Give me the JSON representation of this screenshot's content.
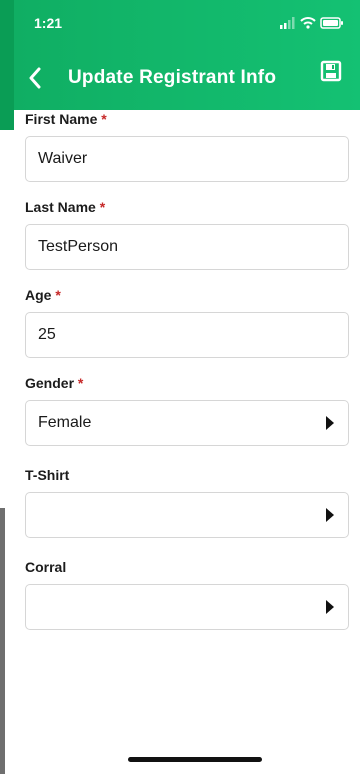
{
  "status_bar": {
    "time": "1:21"
  },
  "header": {
    "title": "Update Registrant Info"
  },
  "form": {
    "first_name": {
      "label": "First Name",
      "required": "*",
      "value": "Waiver"
    },
    "last_name": {
      "label": "Last Name",
      "required": "*",
      "value": "TestPerson"
    },
    "age": {
      "label": "Age",
      "required": "*",
      "value": "25"
    },
    "gender": {
      "label": "Gender",
      "required": "*",
      "value": "Female"
    },
    "tshirt": {
      "label": "T-Shirt",
      "value": ""
    },
    "corral": {
      "label": "Corral",
      "value": ""
    }
  },
  "colors": {
    "header_start": "#10ae63",
    "header_end": "#14c173",
    "required": "#c62828",
    "input_border": "#d6d6d6"
  },
  "icons": {
    "back": "chevron-left-icon",
    "save": "save-icon",
    "signal": "signal-icon",
    "wifi": "wifi-icon",
    "battery": "battery-icon",
    "dropdown": "triangle-right-icon"
  }
}
